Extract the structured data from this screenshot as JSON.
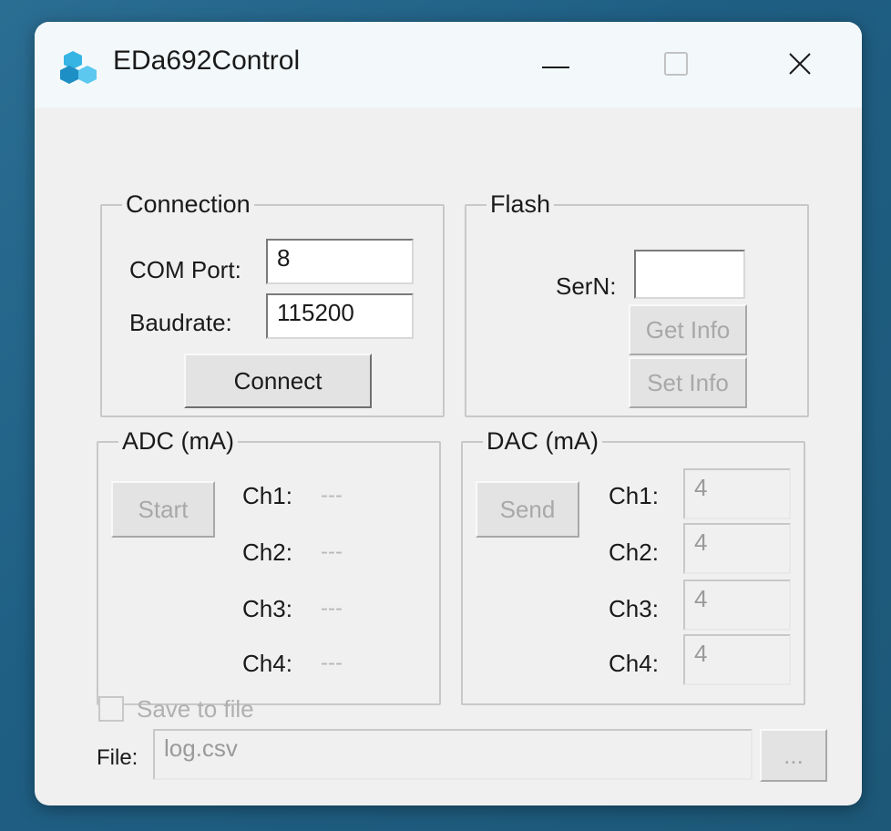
{
  "window": {
    "title": "EDa692Control",
    "icon": "cube-cluster-icon",
    "controls": {
      "minimize": "minimize-icon",
      "maximize": "maximize-icon",
      "close": "close-icon"
    },
    "accent_color": "#2aa5d6"
  },
  "connection": {
    "legend": "Connection",
    "com_port_label": "COM Port:",
    "com_port_value": "8",
    "baudrate_label": "Baudrate:",
    "baudrate_value": "115200",
    "connect_label": "Connect"
  },
  "flash": {
    "legend": "Flash",
    "sern_label": "SerN:",
    "sern_value": "",
    "get_info_label": "Get Info",
    "set_info_label": "Set Info"
  },
  "adc": {
    "legend": "ADC (mA)",
    "start_label": "Start",
    "channels": [
      {
        "label": "Ch1:",
        "value": "---"
      },
      {
        "label": "Ch2:",
        "value": "---"
      },
      {
        "label": "Ch3:",
        "value": "---"
      },
      {
        "label": "Ch4:",
        "value": "---"
      }
    ]
  },
  "dac": {
    "legend": "DAC (mA)",
    "send_label": "Send",
    "channels": [
      {
        "label": "Ch1:",
        "value": "4"
      },
      {
        "label": "Ch2:",
        "value": "4"
      },
      {
        "label": "Ch3:",
        "value": "4"
      },
      {
        "label": "Ch4:",
        "value": "4"
      }
    ]
  },
  "save": {
    "checkbox_label": "Save to file",
    "checked": false,
    "file_label": "File:",
    "file_value": "log.csv",
    "browse_label": "..."
  }
}
